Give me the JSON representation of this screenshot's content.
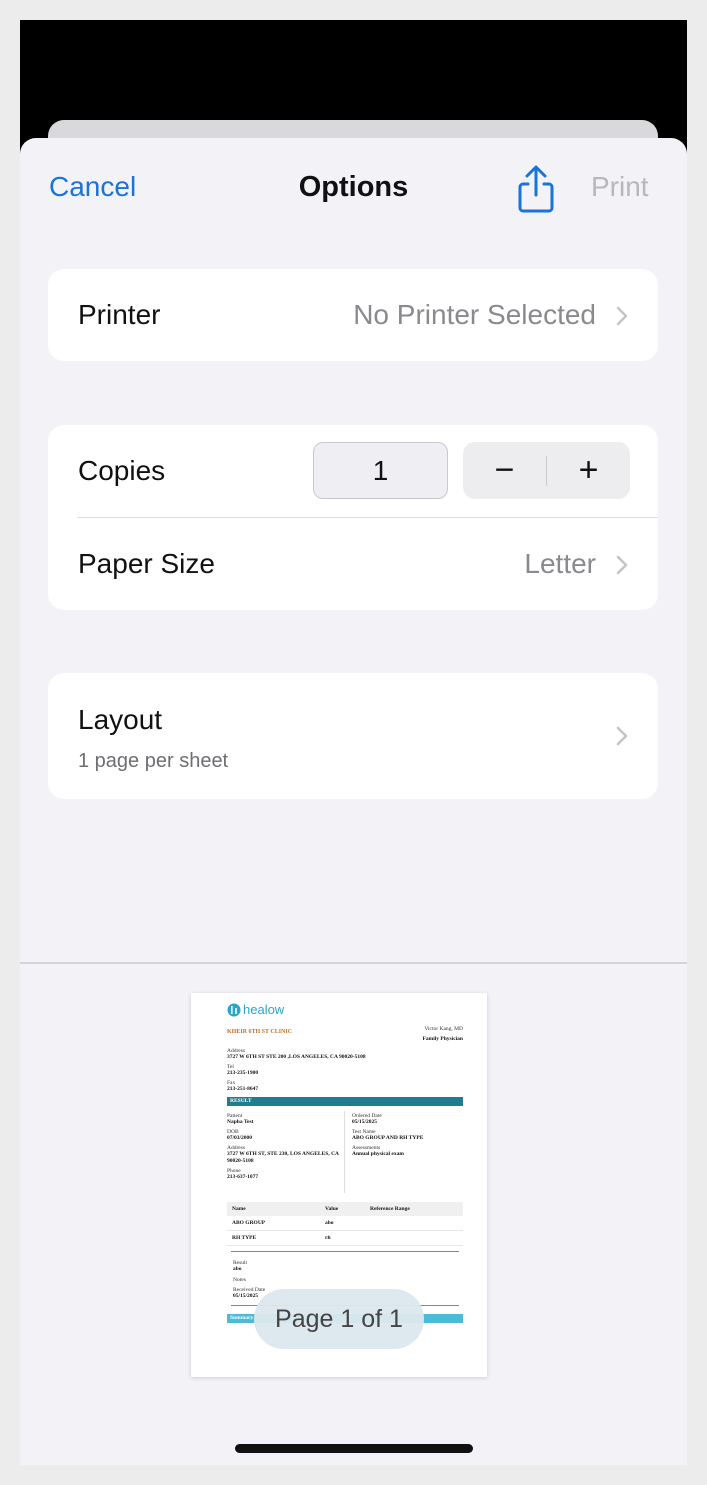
{
  "nav": {
    "cancel_label": "Cancel",
    "title": "Options",
    "share_icon": "share-icon",
    "print_label": "Print"
  },
  "printer": {
    "label": "Printer",
    "value": "No Printer Selected"
  },
  "copies": {
    "label": "Copies",
    "value": "1",
    "decrement_label": "−",
    "increment_label": "+"
  },
  "paper_size": {
    "label": "Paper Size",
    "value": "Letter"
  },
  "layout": {
    "label": "Layout",
    "value": "1 page per sheet"
  },
  "preview": {
    "page_indicator": "Page 1 of 1",
    "document": {
      "brand": "healow",
      "clinic_name": "KHEIR 6TH ST CLINIC",
      "provider_name": "Victor Kang, MD",
      "provider_title": "Family Physician",
      "address_label": "Address",
      "address_value": "3727 W 6TH ST STE 200 ,LOS ANGELES, CA 90020-5108",
      "tel_label": "Tel",
      "tel_value": "213-235-1900",
      "fax_label": "Fax",
      "fax_value": "213-251-8647",
      "result_header": "RESULT",
      "patient_label": "Patient",
      "patient_value": "Napha Test",
      "dob_label": "DOB",
      "dob_value": "07/03/2000",
      "patient_address_label": "Address",
      "patient_address_value": "3727 W 6TH ST, STE 230, LOS ANGELES, CA 90020-5108",
      "phone_label": "Phone",
      "phone_value": "213-637-1077",
      "ordered_date_label": "Ordered Date",
      "ordered_date_value": "05/15/2025",
      "test_name_label": "Test Name",
      "test_name_value": "ABO GROUP AND RH TYPE",
      "assessments_label": "Assessments",
      "assessments_value": "Annual physical exam",
      "table_headers": [
        "Name",
        "Value",
        "Reference Range"
      ],
      "table_rows": [
        [
          "ABO GROUP",
          "abo",
          ""
        ],
        [
          "RH TYPE",
          "rh",
          ""
        ]
      ],
      "result_label": "Result",
      "result_value": "abo",
      "notes_label": "Notes",
      "received_date_label": "Received Date",
      "received_date_value": "05/15/2025",
      "summary_label": "Summary"
    }
  },
  "colors": {
    "accent": "#1a73d9",
    "sheet_background": "#f2f2f7",
    "disabled_text": "#b8b8bc",
    "doc_teal": "#1f7d8f",
    "doc_orange": "#c0722a"
  }
}
